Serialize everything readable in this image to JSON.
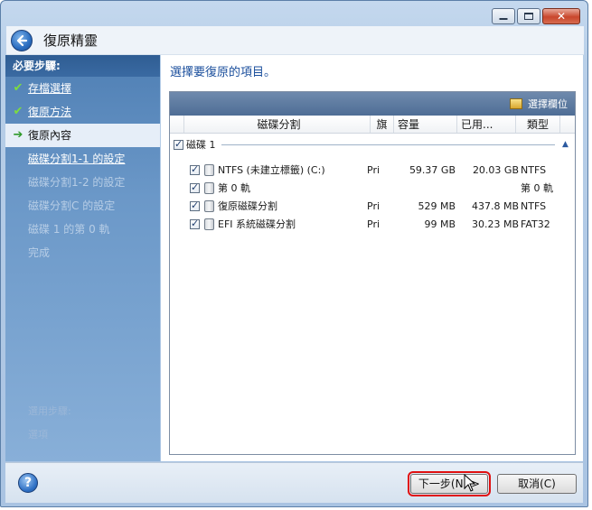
{
  "window": {
    "title": "復原精靈",
    "caption": {
      "minimize": "minimize",
      "maximize": "maximize",
      "close": "✕"
    }
  },
  "sidebar": {
    "header": "必要步驟:",
    "steps": [
      {
        "label": "存檔選擇",
        "state": "done"
      },
      {
        "label": "復原方法",
        "state": "done"
      },
      {
        "label": "復原內容",
        "state": "current"
      },
      {
        "label": "磁碟分割1-1 的設定",
        "state": "active-sub"
      },
      {
        "label": "磁碟分割1-2 的設定",
        "state": "disabled"
      },
      {
        "label": "磁碟分割C 的設定",
        "state": "disabled"
      },
      {
        "label": "磁碟 1 的第 0 軌",
        "state": "disabled"
      },
      {
        "label": "完成",
        "state": "disabled"
      }
    ],
    "optional_header": "選用步驟:",
    "optional_item": "選項"
  },
  "main": {
    "title": "選擇要復原的項目。",
    "toolbar_button": "選擇欄位",
    "columns": [
      "磁碟分割",
      "旗",
      "容量",
      "已用...",
      "類型"
    ],
    "disk": {
      "label": "磁碟 1"
    },
    "partitions": [
      {
        "name": "NTFS (未建立標籤) (C:)",
        "flag": "Pri",
        "capacity": "59.37 GB",
        "used": "20.03 GB",
        "type": "NTFS"
      },
      {
        "name": "第 0 軌",
        "flag": "",
        "capacity": "",
        "used": "",
        "type": "第 0 軌"
      },
      {
        "name": "復原磁碟分割",
        "flag": "Pri",
        "capacity": "529 MB",
        "used": "437.8 MB",
        "type": "NTFS"
      },
      {
        "name": "EFI 系統磁碟分割",
        "flag": "Pri",
        "capacity": "99 MB",
        "used": "30.23 MB",
        "type": "FAT32"
      }
    ]
  },
  "footer": {
    "help": "?",
    "next_label": "下一步(N) >",
    "cancel_label": "取消(C)"
  },
  "colors": {
    "accent": "#1a4e9c",
    "highlight_border": "#e01010",
    "sidebar_top": "#4f7fb4"
  }
}
